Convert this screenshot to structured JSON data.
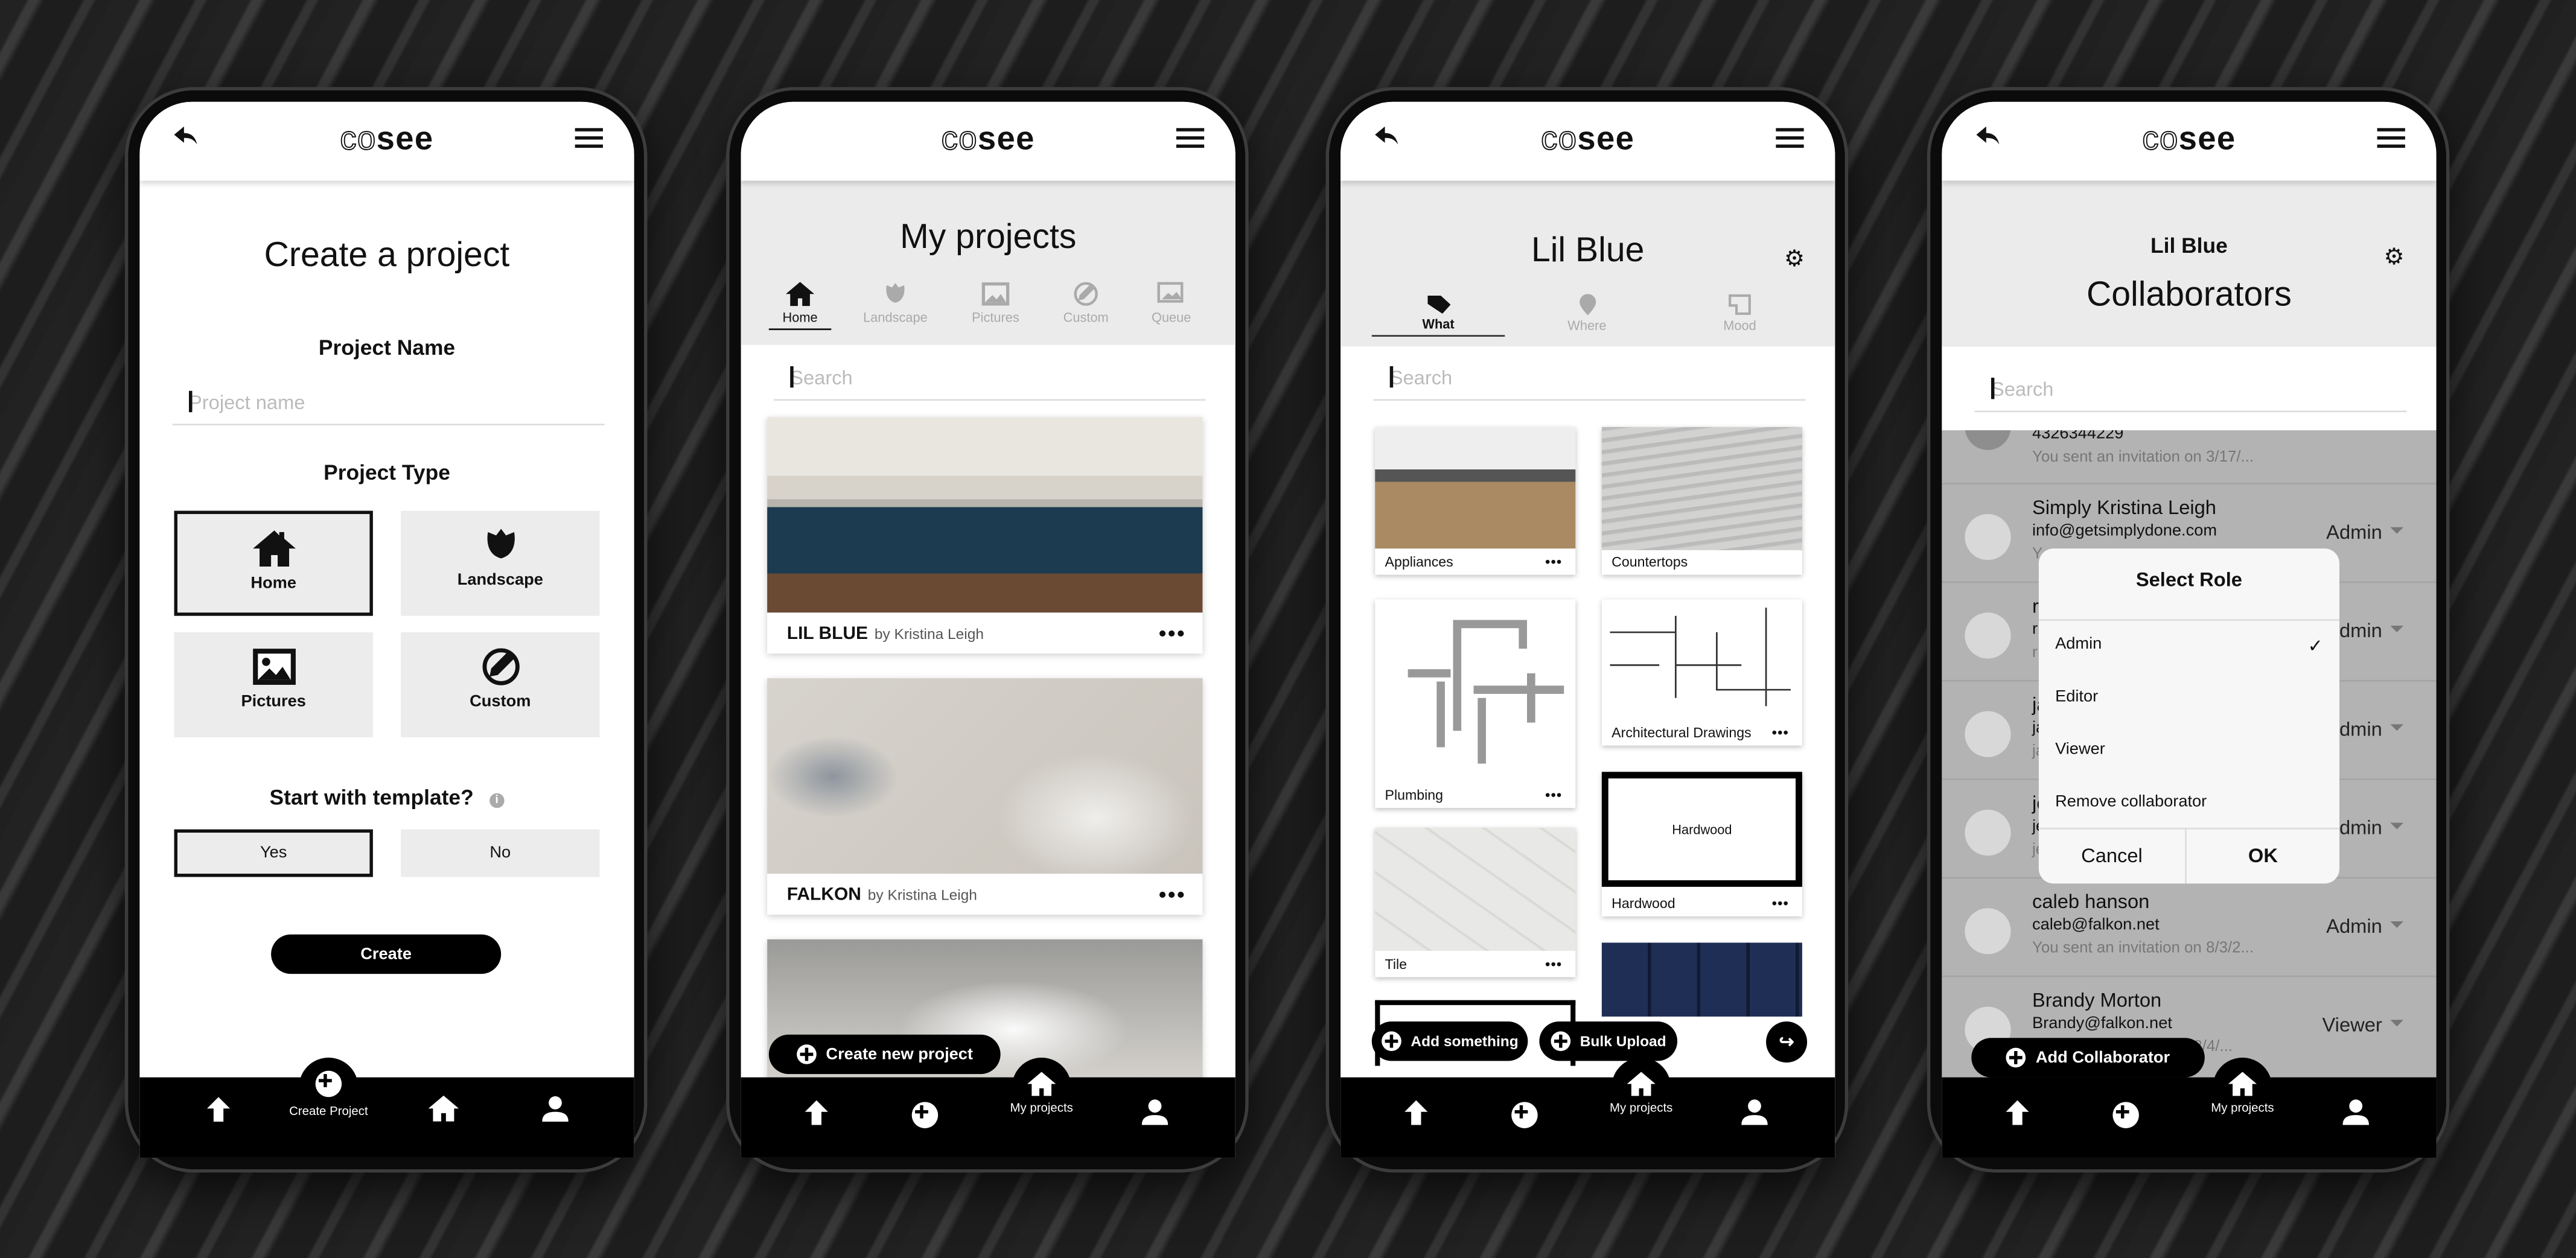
{
  "brand": {
    "logo_light": "co",
    "logo_bold": "see"
  },
  "phone1": {
    "title": "Create a project",
    "name_label": "Project Name",
    "name_placeholder": "Project name",
    "type_label": "Project Type",
    "types": [
      {
        "label": "Home",
        "icon": "house-icon",
        "selected": true
      },
      {
        "label": "Landscape",
        "icon": "tulip-icon",
        "selected": false
      },
      {
        "label": "Pictures",
        "icon": "picture-icon",
        "selected": false
      },
      {
        "label": "Custom",
        "icon": "pencil-circle-icon",
        "selected": false
      }
    ],
    "template_label": "Start with template?",
    "template_options": [
      {
        "label": "Yes",
        "selected": true
      },
      {
        "label": "No",
        "selected": false
      }
    ],
    "create_button": "Create",
    "nav": {
      "active_label": "Create Project"
    }
  },
  "phone2": {
    "title": "My projects",
    "tabs": [
      "Home",
      "Landscape",
      "Pictures",
      "Custom",
      "Queue"
    ],
    "active_tab": "Home",
    "search_placeholder": "Search",
    "projects": [
      {
        "name": "LIL BLUE",
        "by": "by Kristina Leigh"
      },
      {
        "name": "FALKON",
        "by": "by Kristina Leigh"
      }
    ],
    "create_button": "Create new project",
    "nav": {
      "active_label": "My projects"
    }
  },
  "phone3": {
    "title": "Lil Blue",
    "tabs": [
      "What",
      "Where",
      "Mood"
    ],
    "active_tab": "What",
    "search_placeholder": "Search",
    "items": [
      "Appliances",
      "Countertops",
      "Plumbing",
      "Architectural Drawings",
      "Hardwood",
      "Tile"
    ],
    "hardwood_placeholder": "Hardwood",
    "add_button": "Add something",
    "bulk_button": "Bulk Upload",
    "nav": {
      "active_label": "My projects"
    }
  },
  "phone4": {
    "project": "Lil Blue",
    "title": "Collaborators",
    "search_placeholder": "Search",
    "collaborators": [
      {
        "name": "4326344229",
        "email": "",
        "note": "You sent an invitation on 3/17/...",
        "role": ""
      },
      {
        "name": "Simply Kristina Leigh",
        "email": "info@getsimplydone.com",
        "note": "Y",
        "role": "Admin"
      },
      {
        "name": "r",
        "email": "r",
        "note": "r",
        "role": "Admin"
      },
      {
        "name": "ja",
        "email": "ja",
        "note": "ja",
        "role": "Admin"
      },
      {
        "name": "je",
        "email": "je",
        "note": "je",
        "role": "Admin"
      },
      {
        "name": "caleb hanson",
        "email": "caleb@falkon.net",
        "note": "You sent an invitation on 8/3/2...",
        "role": "Admin"
      },
      {
        "name": "Brandy Morton",
        "email": "Brandy@falkon.net",
        "note": "on 8/4/...",
        "role": "Viewer"
      }
    ],
    "dialog": {
      "title": "Select Role",
      "options": [
        "Admin",
        "Editor",
        "Viewer",
        "Remove collaborator"
      ],
      "selected": "Admin",
      "cancel": "Cancel",
      "ok": "OK"
    },
    "add_button": "Add Collaborator",
    "nav": {
      "active_label": "My projects"
    }
  }
}
